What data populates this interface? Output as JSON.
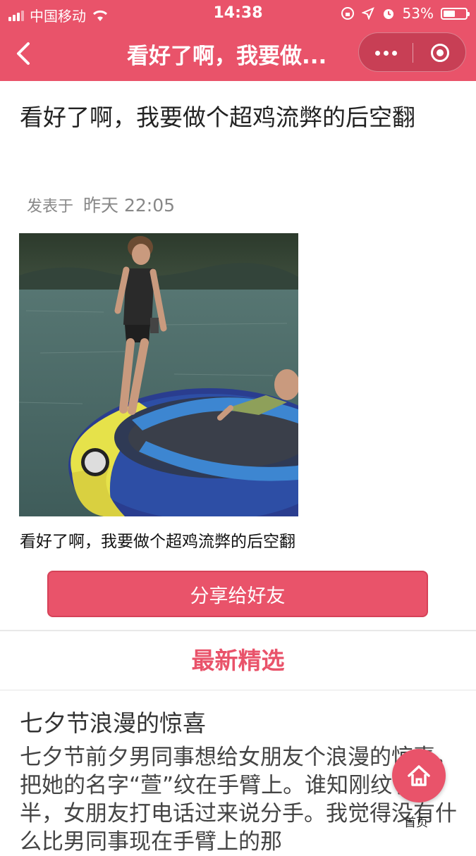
{
  "status_bar": {
    "carrier": "中国移动",
    "time": "14:38",
    "battery_percent": "53%",
    "battery_level": 0.53
  },
  "navbar": {
    "title": "看好了啊，我要做...",
    "back_icon": "chevron-left-icon",
    "more_icon": "more-dots-icon",
    "close_icon": "target-circle-icon"
  },
  "article": {
    "title": "看好了啊，我要做个超鸡流弊的后空翻",
    "meta_prefix": "发表于",
    "meta_time": "昨天 22:05",
    "caption": "看好了啊，我要做个超鸡流弊的后空翻",
    "share_label": "分享给好友"
  },
  "featured": {
    "section_title": "最新精选",
    "post_title": "七夕节浪漫的惊喜",
    "post_excerpt": "七夕节前夕男同事想给女朋友个浪漫的惊喜，把她的名字“萱”纹在手臂上。谁知刚纹了一半，女朋友打电话过来说分手。我觉得没有什么比男同事现在手臂上的那"
  },
  "home_button": {
    "label": "首页",
    "icon": "home-icon"
  },
  "colors": {
    "accent": "#e9536a"
  }
}
